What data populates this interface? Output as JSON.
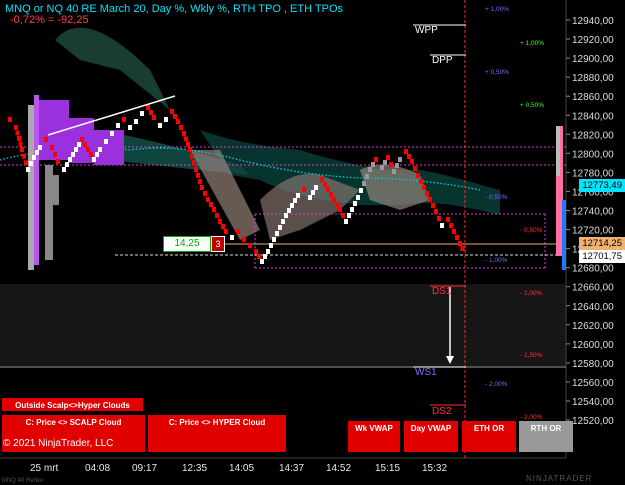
{
  "header": {
    "title": "MNQ or NQ 40 RE March 20, Day %, Wkly %, RTH TPO , ETH TPOs",
    "change": "-0,72% = -92,25"
  },
  "levels": {
    "wpp": "WPP",
    "dpp": "DPP",
    "ds": "DS1",
    "ws": "WS1",
    "ds2": "DS2"
  },
  "percent_labels": [
    {
      "text": "+ 1,00%",
      "color": "#7a6cff"
    },
    {
      "text": "+ 1,00%",
      "color": "#33ff33"
    },
    {
      "text": "+ 0,50%",
      "color": "#7a6cff"
    },
    {
      "text": "+ 0,50%",
      "color": "#33ff33"
    },
    {
      "text": "- 0,50%",
      "color": "#7a6cff"
    },
    {
      "text": "- 0,50%",
      "color": "#ff3333"
    },
    {
      "text": "- 1,00%",
      "color": "#7a6cff"
    },
    {
      "text": "- 1,00%",
      "color": "#ff3333"
    },
    {
      "text": "- 1,50%",
      "color": "#ff3333"
    },
    {
      "text": "- 2,00%",
      "color": "#7a6cff"
    },
    {
      "text": "- 2,00%",
      "color": "#ff3333"
    }
  ],
  "price_axis": [
    "12940,00",
    "12920,00",
    "12900,00",
    "12880,00",
    "12860,00",
    "12840,00",
    "12820,00",
    "12800,00",
    "12780,00",
    "12760,00",
    "12740,00",
    "12720,00",
    "12700,00",
    "12680,00",
    "12660,00",
    "12640,00",
    "12620,00",
    "12600,00",
    "12580,00",
    "12560,00",
    "12540,00",
    "12520,00"
  ],
  "price_tags": {
    "cyan": "12773,49",
    "orange": "12714,25",
    "white": "12701,75"
  },
  "range_box": {
    "value": "14,25",
    "count": "3"
  },
  "time_axis": [
    "25 mrt",
    "04:08",
    "09:17",
    "12:35",
    "14:05",
    "14:37",
    "14:52",
    "15:15",
    "15:32"
  ],
  "buttons": {
    "outside": "Outside Scalp<>Hyper Clouds",
    "scalp": "C: Price <> SCALP Cloud",
    "hyper": "C: Price <> HYPER Cloud",
    "wk_vwap": "Wk VWAP",
    "day_vwap": "Day VWAP",
    "eth_or": "ETH OR",
    "rth_or": "RTH OR"
  },
  "copyright": "© 2021 NinjaTrader, LLC",
  "watermark": "NINJATRADER",
  "footer_note": "MNQ 40 Renko",
  "colors": {
    "up": "#ffffff",
    "down": "#ff0000",
    "accent_cyan": "#00e5ff",
    "accent_magenta": "#ff00ff"
  }
}
